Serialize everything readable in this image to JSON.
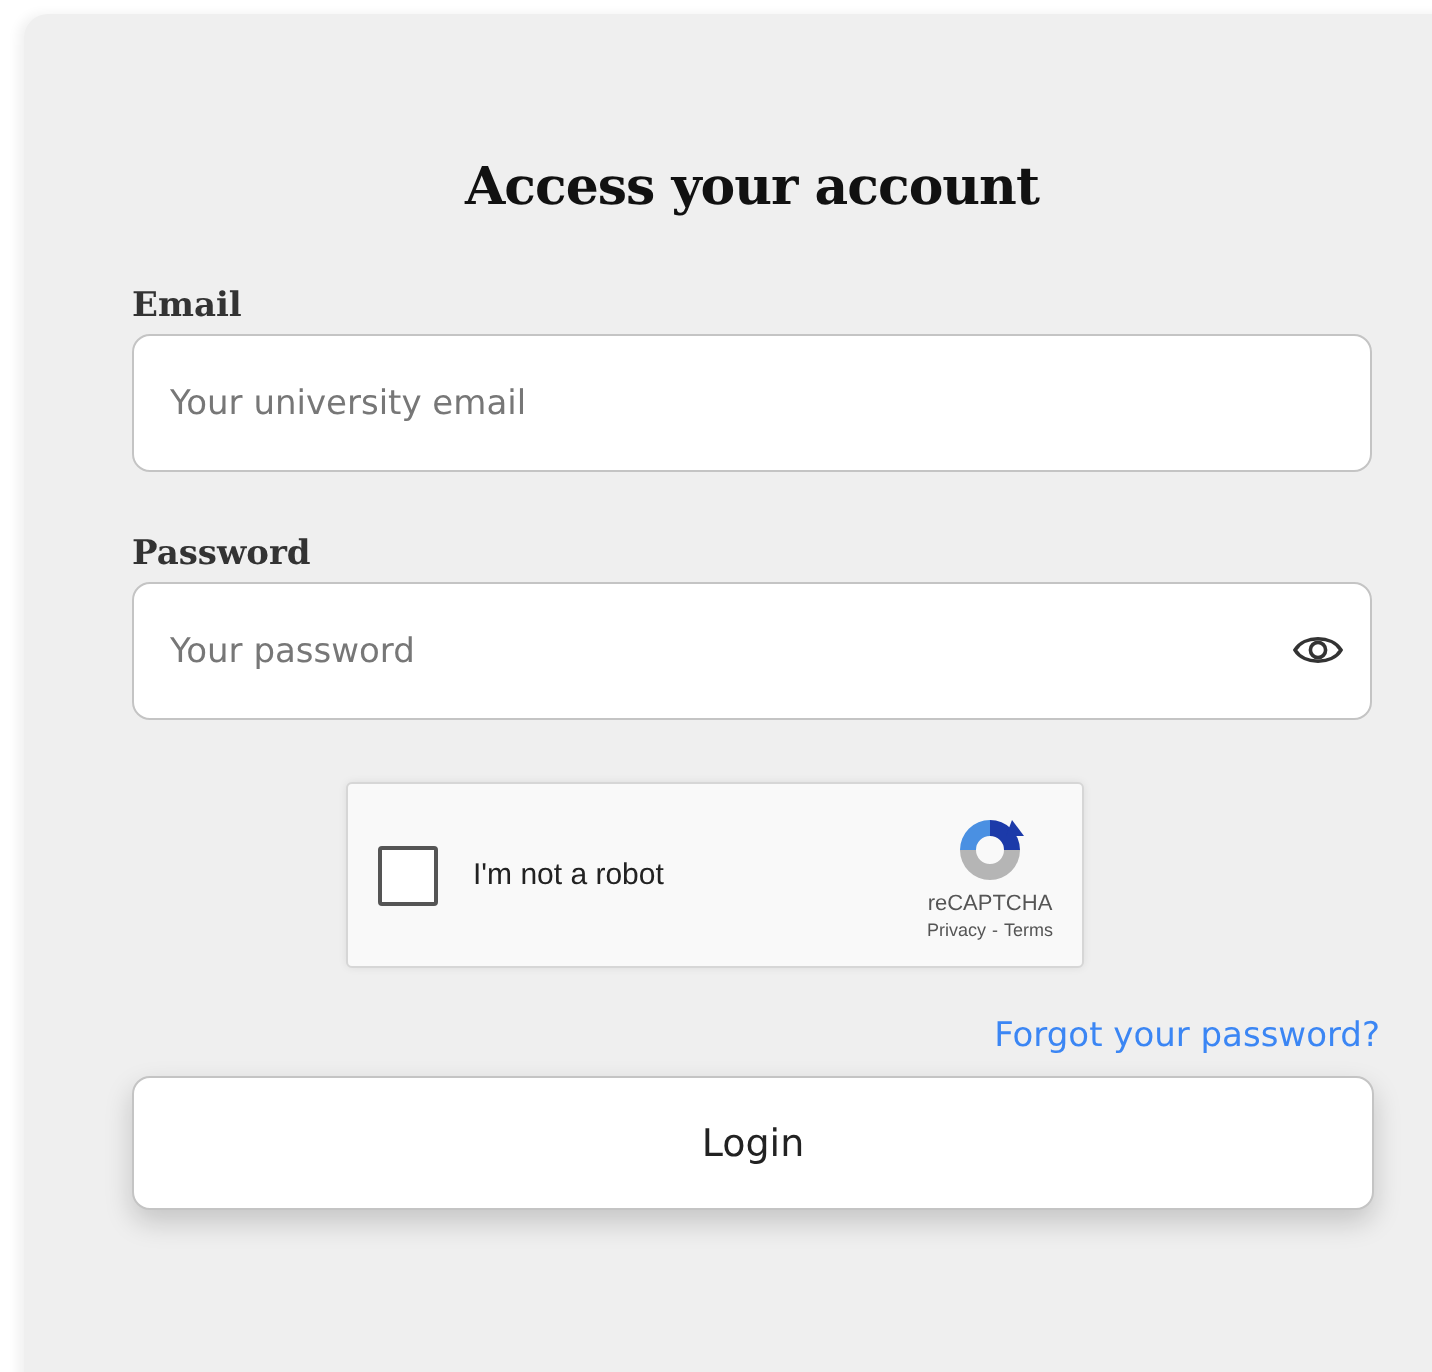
{
  "title": "Access your account",
  "fields": [
    {
      "label": "Email",
      "placeholder": "Your university email",
      "kind": "text"
    },
    {
      "label": "Password",
      "placeholder": "Your password",
      "kind": "password"
    }
  ],
  "captcha": {
    "label": "I'm not a robot",
    "checked": false,
    "brand": "reCAPTCHA",
    "privacy": "Privacy",
    "separator": "-",
    "terms": "Terms"
  },
  "forgot_link": "Forgot your password?",
  "login_button": "Login"
}
